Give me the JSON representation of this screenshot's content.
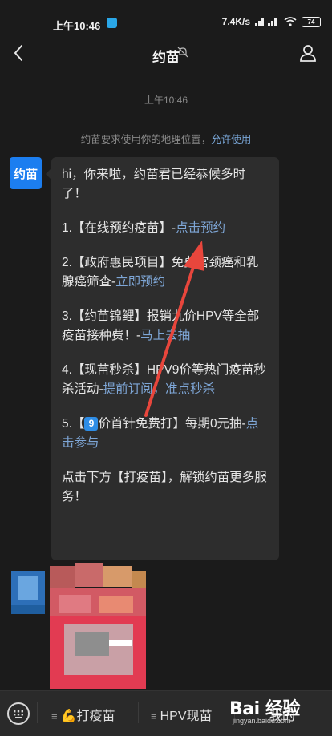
{
  "status_bar": {
    "time": "上午10:46",
    "network_speed": "7.4K/s",
    "battery": "74"
  },
  "header": {
    "title": "约苗"
  },
  "chat": {
    "timestamp": "上午10:46",
    "system_text": "约苗要求使用你的地理位置，",
    "system_link": "允许使用",
    "avatar_label": "约苗",
    "message": {
      "greeting": "hi，你来啦，约苗君已经恭候多时了！",
      "item1_text": "1.【在线预约疫苗】-",
      "item1_link": "点击预约",
      "item2_text": "2.【政府惠民项目】免费宫颈癌和乳腺癌筛查-",
      "item2_link": "立即预约",
      "item3_text": "3.【约苗锦鲤】报销九价HPV等全部疫苗接种费！-",
      "item3_link": "马上去抽",
      "item4_text": "4.【现苗秒杀】HPV9价等热门疫苗秒杀活动-",
      "item4_link": "提前订阅，准点秒杀",
      "item5_prefix": "5.【",
      "item5_badge": "9",
      "item5_text": "价首针免费打】每期0元抽-",
      "item5_link": "点击参与",
      "footer": "点击下方【打疫苗】，解锁约苗更多服务！"
    }
  },
  "bottom_menu": {
    "item1_label": "打疫苗",
    "item2_label": "HPV现苗",
    "item3_label": "我的"
  },
  "watermark": {
    "logo": "Bai 经验",
    "url": "jingyan.baidu.com"
  },
  "colors": {
    "link": "#7ea6d6",
    "avatar": "#1c7ef0",
    "arrow": "#e8463c"
  }
}
